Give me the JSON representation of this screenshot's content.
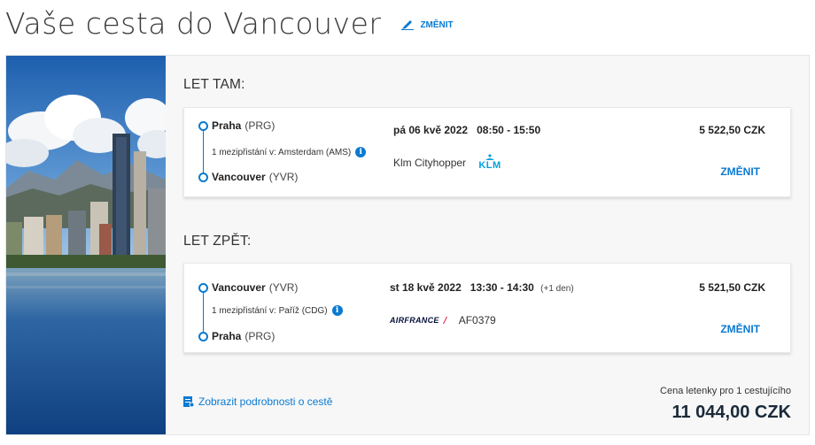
{
  "header": {
    "title": "Vaše cesta do Vancouver",
    "change_label": "ZMĚNIT"
  },
  "outbound": {
    "section_label": "LET TAM:",
    "origin_city": "Praha",
    "origin_code": "(PRG)",
    "destination_city": "Vancouver",
    "destination_code": "(YVR)",
    "stopover": "1 mezipřistání v: Amsterdam (AMS)",
    "date": "pá 06 kvě 2022",
    "time": "08:50 - 15:50",
    "airline": "Klm Cityhopper",
    "airline_logo": "KLM",
    "price": "5 522,50 CZK",
    "change_label": "ZMĚNIT"
  },
  "inbound": {
    "section_label": "LET ZPĚT:",
    "origin_city": "Vancouver",
    "origin_code": "(YVR)",
    "destination_city": "Praha",
    "destination_code": "(PRG)",
    "stopover": "1 mezipřistání v: Paříž (CDG)",
    "date": "st 18 kvě 2022",
    "time": "13:30 - 14:30",
    "next_day": "(+1 den)",
    "airline_logo": "AIRFRANCE",
    "flight_number": "AF0379",
    "price": "5 521,50 CZK",
    "change_label": "ZMĚNIT"
  },
  "footer": {
    "details_link": "Zobrazit podrobnosti o cestě",
    "fare_label": "Cena letenky pro 1 cestujícího",
    "fare_total": "11 044,00 CZK"
  },
  "colors": {
    "accent": "#0a7ad1",
    "klm_blue": "#00a1de",
    "airfrance_red": "#e4002b",
    "airfrance_navy": "#051039"
  },
  "icons": {
    "edit": "pencil-icon",
    "info": "info-icon",
    "details": "document-icon"
  }
}
